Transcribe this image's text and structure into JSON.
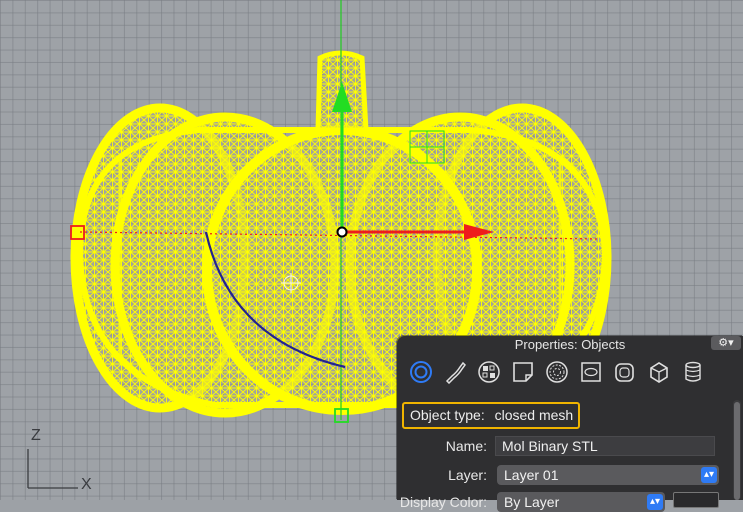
{
  "viewport": {
    "axis_z": "Z",
    "axis_x": "X",
    "colors": {
      "mesh": "#ffff00",
      "grid_bg": "#9ea2a7",
      "axis_red": "#ee1c1c",
      "axis_green": "#22dd22",
      "rotate_arc": "#23238f"
    }
  },
  "panel": {
    "title": "Properties: Objects",
    "gear_icon": "gear-icon",
    "tabs": [
      {
        "name": "object-tab",
        "icon": "circle-target-icon",
        "active": true
      },
      {
        "name": "curve-tab",
        "icon": "curve-icon",
        "active": false
      },
      {
        "name": "material-tab",
        "icon": "checker-ball-icon",
        "active": false
      },
      {
        "name": "page-tab",
        "icon": "page-icon",
        "active": false
      },
      {
        "name": "texture-tab",
        "icon": "texture-ball-icon",
        "active": false
      },
      {
        "name": "decal-tab",
        "icon": "decal-icon",
        "active": false
      },
      {
        "name": "mesh-tab",
        "icon": "rounded-box-icon",
        "active": false
      },
      {
        "name": "box-tab",
        "icon": "box-icon",
        "active": false
      },
      {
        "name": "cylinder-tab",
        "icon": "cylinder-stack-icon",
        "active": false
      }
    ],
    "object_type_label": "Object type:",
    "object_type_value": "closed mesh",
    "name_label": "Name:",
    "name_value": "Mol Binary STL",
    "layer_label": "Layer:",
    "layer_value": "Layer 01",
    "display_color_label": "Display Color:",
    "display_color_value": "By Layer",
    "accent": "#f0b400"
  }
}
